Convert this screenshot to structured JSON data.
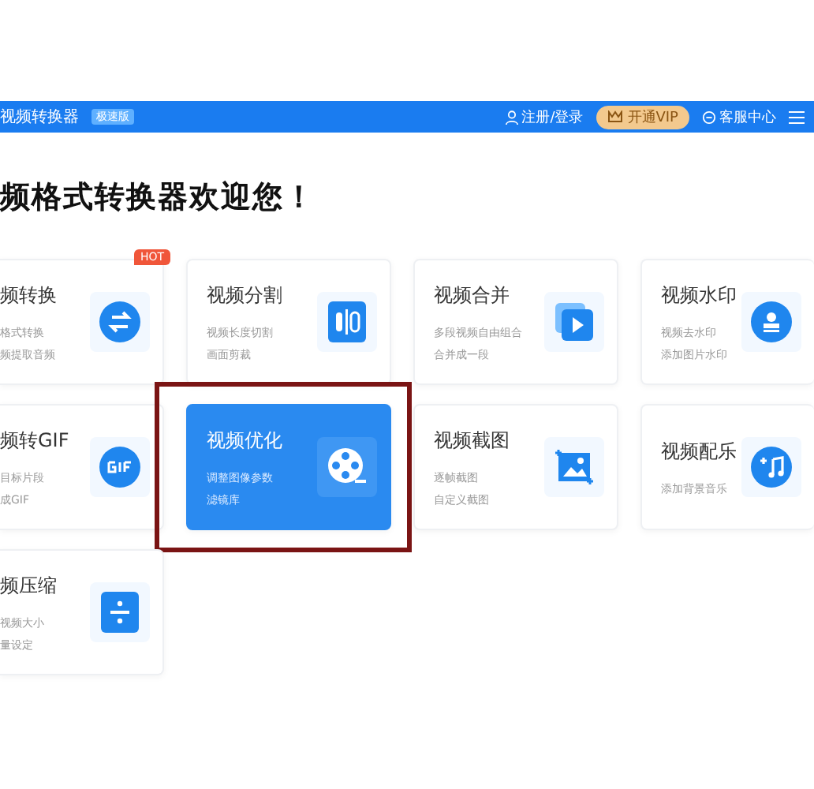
{
  "header": {
    "app_name": "视频转换器",
    "badge": "极速版",
    "login": "注册/登录",
    "vip": "开通VIP",
    "support": "客服中心"
  },
  "welcome": "频格式转换器欢迎您！",
  "cards": [
    {
      "title": "频转换",
      "lines": [
        "格式转换",
        "频提取音频"
      ],
      "hot": "HOT",
      "selected": false
    },
    {
      "title": "视频分割",
      "lines": [
        "视频长度切割",
        "画面剪裁"
      ],
      "selected": false
    },
    {
      "title": "视频合并",
      "lines": [
        "多段视频自由组合",
        "合并成一段"
      ],
      "selected": false
    },
    {
      "title": "视频水印",
      "lines": [
        "视频去水印",
        "添加图片水印"
      ],
      "selected": false
    },
    {
      "title": "频转GIF",
      "lines": [
        "目标片段",
        "成GIF"
      ],
      "selected": false
    },
    {
      "title": "视频优化",
      "lines": [
        "调整图像参数",
        "滤镜库"
      ],
      "selected": true
    },
    {
      "title": "视频截图",
      "lines": [
        "逐帧截图",
        "自定义截图"
      ],
      "selected": false
    },
    {
      "title": "视频配乐",
      "lines": [
        "添加背景音乐"
      ],
      "selected": false
    },
    {
      "title": "频压缩",
      "lines": [
        "视频大小",
        "量设定"
      ],
      "selected": false
    }
  ]
}
